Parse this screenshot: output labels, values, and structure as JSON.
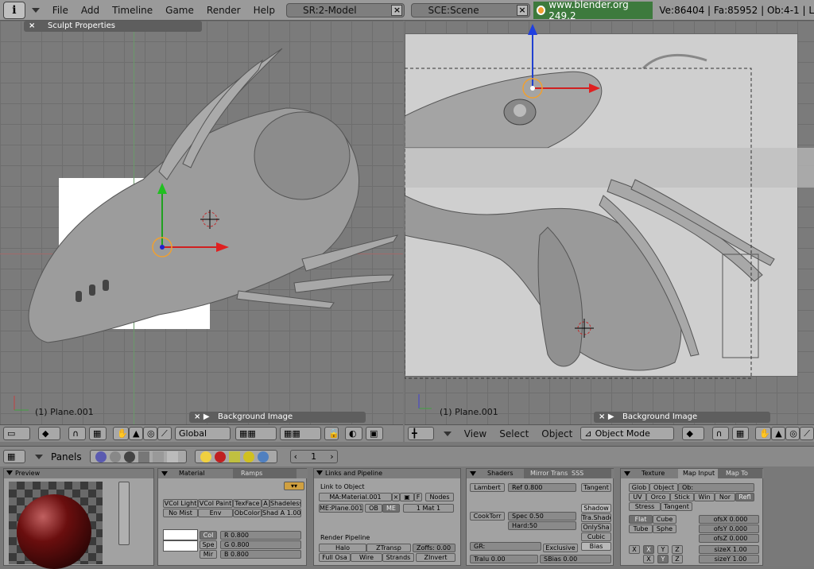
{
  "topbar": {
    "info_icon": "info-icon",
    "menus": [
      "File",
      "Add",
      "Timeline",
      "Game",
      "Render",
      "Help"
    ],
    "screen": "SR:2-Model",
    "scene": "SCE:Scene",
    "version": "www.blender.org 249.2",
    "stats": "Ve:86404 | Fa:85952 | Ob:4-1 | L"
  },
  "left_view": {
    "panel_title": "Sculpt Properties",
    "object_label": "(1) Plane.001",
    "bg_panel": "Background Image",
    "orientation": "Global"
  },
  "right_view": {
    "object_label": "(1) Plane.001",
    "bg_panel": "Background Image",
    "menus": [
      "View",
      "Select",
      "Object"
    ],
    "mode": "Object Mode"
  },
  "buttons_window": {
    "panels_label": "Panels",
    "frame": "1",
    "preview_title": "Preview",
    "material_tab": "Material",
    "ramps_tab": "Ramps",
    "vcol_light": "VCol Light",
    "vcol_paint": "VCol Paint",
    "texface": "TexFace",
    "a_btn": "A",
    "shadeless": "Shadeless",
    "no_mist": "No Mist",
    "env": "Env",
    "obcolor": "ObColor",
    "shad_a": "Shad A 1.00",
    "col": "Col",
    "spe": "Spe",
    "mir": "Mir",
    "r": "R 0.800",
    "g": "G 0.800",
    "b": "B 0.800",
    "links_title": "Links and Pipeline",
    "link_to_object": "Link to Object",
    "ma": "MA:Material.001",
    "f": "F",
    "nodes": "Nodes",
    "me": "ME:Plane.001",
    "ob": "OB",
    "me_btn": "ME",
    "mat": "1 Mat 1",
    "render_pipeline": "Render Pipeline",
    "halo": "Halo",
    "ztransp": "ZTransp",
    "zoffs": "Zoffs: 0.00",
    "full_osa": "Full Osa",
    "wire": "Wire",
    "strands": "Strands",
    "zinvert": "ZInvert",
    "shaders_tab": "Shaders",
    "mirror_tab": "Mirror Trans",
    "sss_tab": "SSS",
    "lambert": "Lambert",
    "ref": "Ref  0.800",
    "tangent": "Tangent",
    "shadow": "Shadow",
    "cooktorr": "CookTorr",
    "spec": "Spec 0.50",
    "hard": "Hard:50",
    "trashado": "Tra.Shado",
    "onlysha": "OnlySha",
    "cubic": "Cubic",
    "bias": "Bias",
    "gr": "GR:",
    "exclusive": "Exclusive",
    "tralu": "Tralu 0.00",
    "sbias": "SBias 0.00",
    "texture_tab": "Texture",
    "mapinput_tab": "Map Input",
    "mapto_tab": "Map To",
    "glob": "Glob",
    "object": "Object",
    "ob_field": "Ob:",
    "uv": "UV",
    "orco": "Orco",
    "stick": "Stick",
    "win": "Win",
    "nor": "Nor",
    "refl": "Refl",
    "stress": "Stress",
    "tangent2": "Tangent",
    "flat": "Flat",
    "cube": "Cube",
    "tube": "Tube",
    "sphe": "Sphe",
    "ofsx": "ofsX 0.000",
    "ofsy": "ofsY 0.000",
    "ofsz": "ofsZ 0.000",
    "x": "X",
    "y": "Y",
    "z": "Z",
    "sizex": "sizeX 1.00",
    "sizey": "sizeY 1.00"
  }
}
